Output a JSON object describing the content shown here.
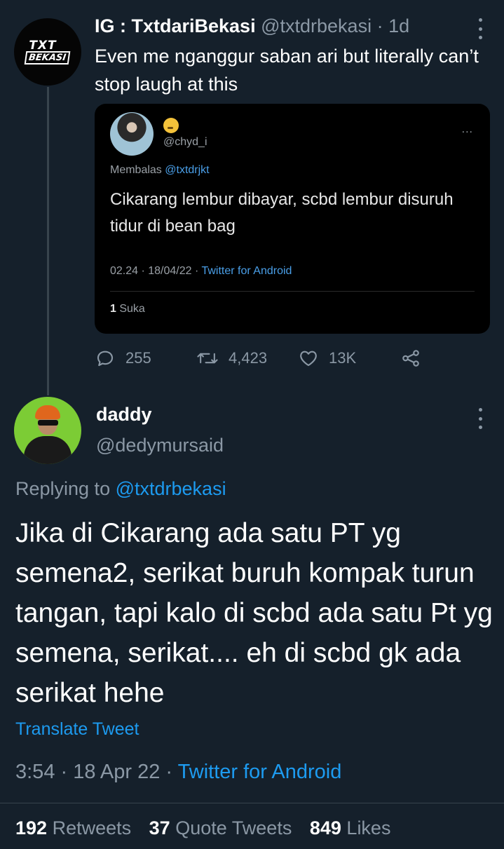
{
  "parent_tweet": {
    "avatar_logo_line1": "TXT",
    "avatar_logo_line2": "BEKASI",
    "display_name": "IG : TxtdariBekasi",
    "handle": "@txtdrbekasi",
    "separator": "·",
    "time_ago": "1d",
    "text": "Even me nganggur saban ari but literally can’t stop laugh at this",
    "embedded": {
      "emoji": "thinking-face",
      "handle": "@chyd_i",
      "menu": "...",
      "reply_prefix": "Membalas",
      "reply_to": "@txtdrjkt",
      "text": "Cikarang lembur dibayar, scbd lembur disuruh tidur di bean bag",
      "time": "02.24 · 18/04/22 ·",
      "source": "Twitter for Android",
      "likes_count": "1",
      "likes_label": "Suka"
    },
    "actions": {
      "replies": "255",
      "retweets": "4,423",
      "likes": "13K"
    }
  },
  "reply_tweet": {
    "display_name": "daddy",
    "handle": "@dedymursaid",
    "replying_prefix": "Replying to",
    "replying_to": "@txtdrbekasi",
    "text": "Jika di Cikarang ada satu PT yg semena2, serikat buruh kompak turun tangan, tapi kalo di scbd ada satu Pt yg semena, serikat.... eh di scbd gk ada serikat hehe",
    "translate_label": "Translate Tweet",
    "time": "3:54 · 18 Apr 22 ·",
    "source": "Twitter for Android",
    "stats": {
      "retweets_count": "192",
      "retweets_label": "Retweets",
      "quotes_count": "37",
      "quotes_label": "Quote Tweets",
      "likes_count": "849",
      "likes_label": "Likes"
    }
  },
  "colors": {
    "background": "#15202b",
    "accent": "#1d9bf0",
    "secondary_text": "#8b98a5"
  }
}
